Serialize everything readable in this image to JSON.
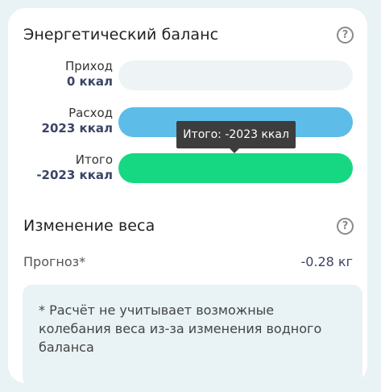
{
  "energy": {
    "title": "Энергетический баланс",
    "help_icon": "question-circle-icon",
    "rows": [
      {
        "name": "Приход",
        "value": "0 ккал",
        "color": "#eef4f6"
      },
      {
        "name": "Расход",
        "value": "2023 ккал",
        "color": "#5dbce8"
      },
      {
        "name": "Итого",
        "value": "-2023 ккал",
        "color": "#17d882"
      }
    ],
    "tooltip": "Итого: -2023 ккал"
  },
  "weight": {
    "title": "Изменение веса",
    "help_icon": "question-circle-icon",
    "forecast_label": "Прогноз*",
    "forecast_value": "-0.28 кг",
    "note": "* Расчёт не учитывает возможные колебания веса из-за изменения водного баланса"
  }
}
